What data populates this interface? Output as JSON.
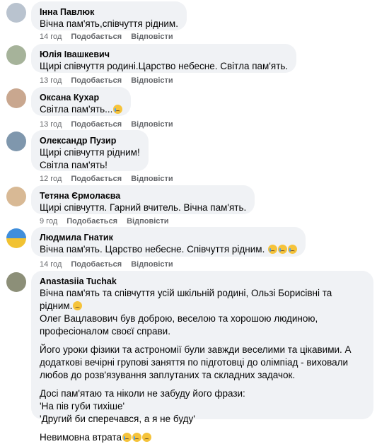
{
  "comments": [
    {
      "author": "Інна Павлюк",
      "text": "Вічна пам'ять,співчуття рідним.",
      "time": "14 год",
      "like": "Подобається",
      "reply": "Відповісти"
    },
    {
      "author": "Юлія Івашкевич",
      "text": "Щирі співчуття родині.Царство небесне. Світла пам'ять.",
      "time": "13 год",
      "like": "Подобається",
      "reply": "Відповісти"
    },
    {
      "author": "Оксана Кухар",
      "text": "Світла пам'ять...",
      "time": "13 год",
      "like": "Подобається",
      "reply": "Відповісти"
    },
    {
      "author": "Олександр Пузир",
      "line1": "Щирі співчуття рідним!",
      "line2": "Світла пам'ять!",
      "time": "12 год",
      "like": "Подобається",
      "reply": "Відповісти"
    },
    {
      "author": "Тетяна Єрмолаєва",
      "text": "Щирі співчуття. Гарний вчитель. Вічна пам'ять.",
      "time": "9 год",
      "like": "Подобається",
      "reply": "Відповісти"
    },
    {
      "author": "Людмила Гнатик",
      "text": "Вічна пам'ять. Царство небесне. Співчуття рідним.",
      "time": "14 год",
      "like": "Подобається",
      "reply": "Відповісти"
    },
    {
      "author": "Anastasiia Tuchak",
      "p1": "Вічна пам'ять та співчуття усій шкільній родині, Ользі Борисівні та рідним.",
      "p1b": "Олег Вацлавович був доброю, веселою та хорошою людиною, професіоналом своєї справи.",
      "p2": "Його уроки фізики та астрономії були завжди веселими та цікавими. А додаткові вечірні групові заняття по підготовці до олімпіад - виховали любов до розв'язування заплутаних та складних задачок.",
      "p3a": "Досі пам'ятаю та ніколи не забуду його фрази:",
      "p3b": "'На пів губи тихіше'",
      "p3c": "'Другий би сперечався, а я не буду'",
      "p4": "Невимовна втрата"
    }
  ]
}
